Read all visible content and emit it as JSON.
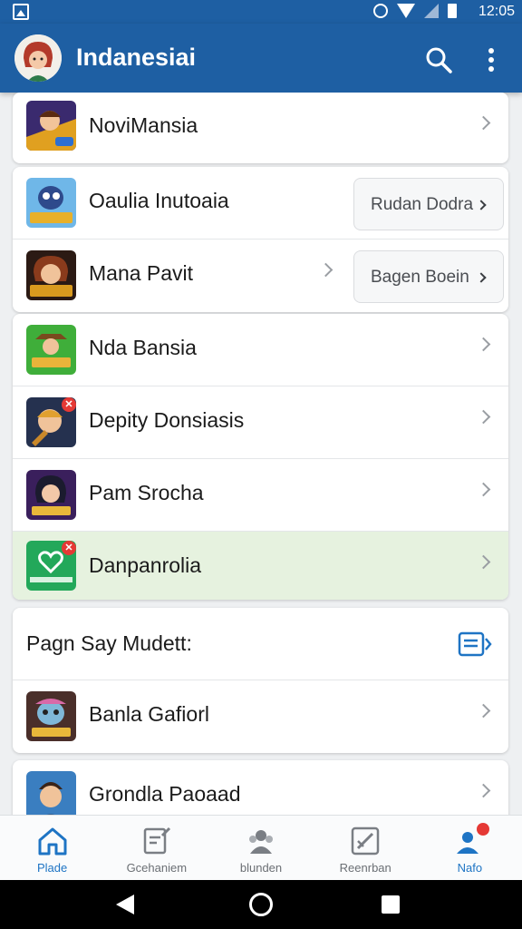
{
  "status_bar": {
    "time": "12:05"
  },
  "app_bar": {
    "title": "Indanesiai"
  },
  "lists": {
    "group1": [
      {
        "label": "NoviMansia",
        "icon": "game-hero-icon"
      }
    ],
    "group2": [
      {
        "label": "Oaulia Inutoaia",
        "icon": "game-robot-icon",
        "pill": "Rudan Dodra"
      },
      {
        "label": "Mana Pavit",
        "icon": "game-warrior-icon",
        "pill": "Bagen Boein"
      }
    ],
    "group3": [
      {
        "label": "Nda Bansia",
        "icon": "game-cowboy-icon"
      },
      {
        "label": "Depity Donsiasis",
        "icon": "game-knight-icon"
      },
      {
        "label": "Pam Srocha",
        "icon": "game-girl-icon"
      },
      {
        "label": "Danpanrolia",
        "icon": "heart-app-icon"
      }
    ],
    "section": {
      "title": "Pagn Say Mudett:",
      "icon": "open-list-icon",
      "items": [
        {
          "label": "Banla Gafiorl",
          "icon": "game-creature-icon"
        }
      ]
    },
    "group5": [
      {
        "label": "Grondla Paoaad",
        "icon": "game-boy-icon"
      }
    ]
  },
  "bottom_nav": [
    {
      "label": "Plade",
      "icon": "home-icon",
      "active": true
    },
    {
      "label": "Gcehaniem",
      "icon": "edit-icon"
    },
    {
      "label": "blunden",
      "icon": "people-icon"
    },
    {
      "label": "Reenrban",
      "icon": "image-edit-icon"
    },
    {
      "label": "Nafo",
      "icon": "account-icon",
      "active": true
    }
  ],
  "colors": {
    "primary": "#1e5fa3",
    "accent": "#1e74c4",
    "highlight_row": "#e6f2df",
    "badge": "#e53935"
  }
}
